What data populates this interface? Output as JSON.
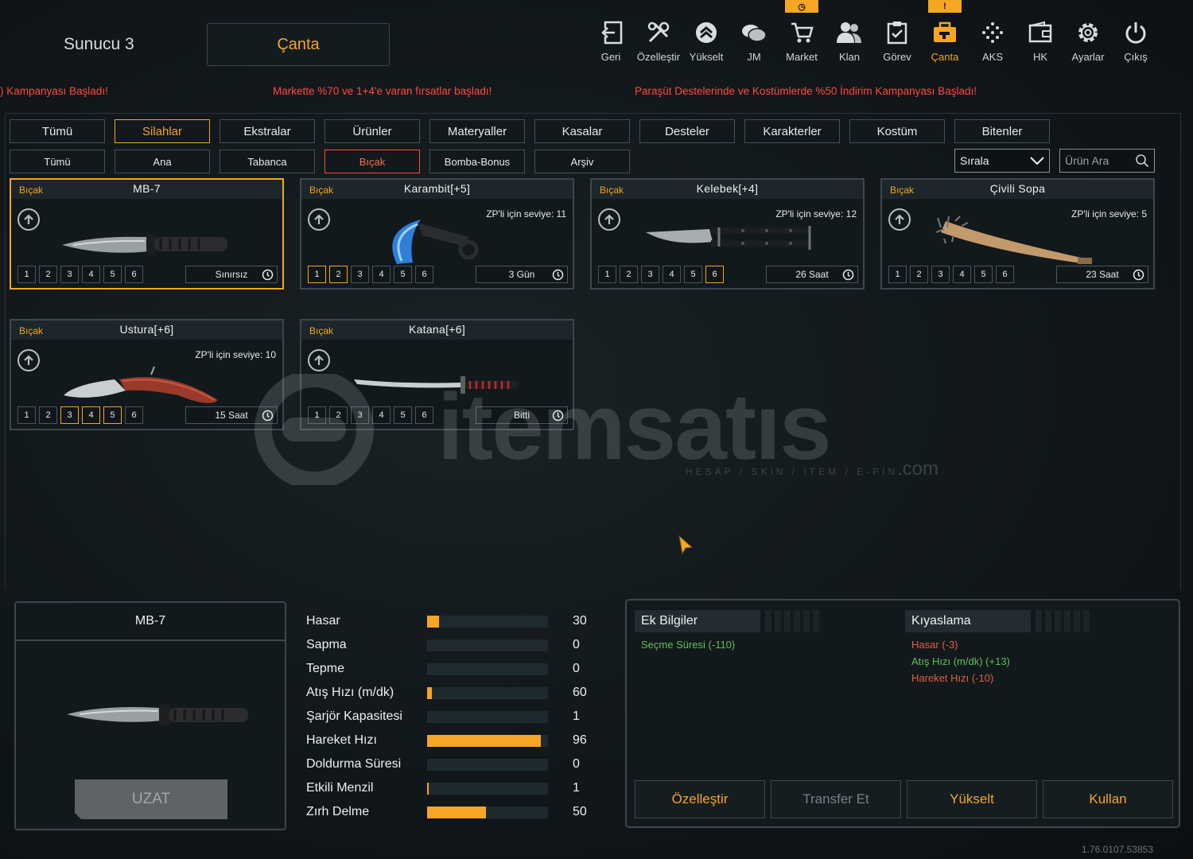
{
  "header": {
    "server": "Sunucu 3",
    "title": "Çanta",
    "nav": [
      {
        "label": "Geri",
        "icon": "back-icon"
      },
      {
        "label": "Özelleştir",
        "icon": "tools-icon"
      },
      {
        "label": "Yükselt",
        "icon": "upgrade-icon"
      },
      {
        "label": "JM",
        "icon": "coins-icon"
      },
      {
        "label": "Market",
        "icon": "cart-icon"
      },
      {
        "label": "Klan",
        "icon": "clan-icon"
      },
      {
        "label": "Görev",
        "icon": "mission-icon"
      },
      {
        "label": "Çanta",
        "icon": "bag-icon"
      },
      {
        "label": "AKS",
        "icon": "aks-icon"
      },
      {
        "label": "HK",
        "icon": "wallet-icon"
      },
      {
        "label": "Ayarlar",
        "icon": "gear-icon"
      },
      {
        "label": "Çıkış",
        "icon": "power-icon"
      }
    ],
    "active_nav": "Çanta"
  },
  "ticker": [
    ") Kampanyası Başladı!",
    "Markette %70 ve 1+4'e varan fırsatlar başladı!",
    "Paraşüt Destelerinde ve Kostümlerde %50 İndirim Kampanyası Başladı!"
  ],
  "tabs": [
    "Tümü",
    "Silahlar",
    "Ekstralar",
    "Ürünler",
    "Materyaller",
    "Kasalar",
    "Desteler",
    "Karakterler",
    "Kostüm",
    "Bitenler"
  ],
  "active_tab": "Silahlar",
  "subtabs": [
    "Tümü",
    "Ana",
    "Tabanca",
    "Bıçak",
    "Bomba-Bonus",
    "Arşiv"
  ],
  "active_subtab": "Bıçak",
  "sort_label": "Sırala",
  "search_placeholder": "Ürün Ara",
  "items": [
    {
      "category": "Bıçak",
      "name": "MB-7",
      "zp": "",
      "duration": "Sınırsız",
      "slots_on": [],
      "selected": true,
      "art": "knife"
    },
    {
      "category": "Bıçak",
      "name": "Karambit[+5]",
      "zp": "ZP'li için seviye: 11",
      "duration": "3 Gün",
      "slots_on": [
        1,
        2
      ],
      "selected": false,
      "art": "karambit"
    },
    {
      "category": "Bıçak",
      "name": "Kelebek[+4]",
      "zp": "ZP'li için seviye: 12",
      "duration": "26 Saat",
      "slots_on": [
        6
      ],
      "selected": false,
      "art": "butterfly"
    },
    {
      "category": "Bıçak",
      "name": "Çivili Sopa",
      "zp": "ZP'li için seviye: 5",
      "duration": "23 Saat",
      "slots_on": [],
      "selected": false,
      "art": "bat"
    },
    {
      "category": "Bıçak",
      "name": "Ustura[+6]",
      "zp": "ZP'li için seviye: 10",
      "duration": "15 Saat",
      "slots_on": [
        3,
        4,
        5
      ],
      "selected": false,
      "art": "razor"
    },
    {
      "category": "Bıçak",
      "name": "Katana[+6]",
      "zp": "",
      "duration": "Bitti",
      "slots_on": [],
      "selected": false,
      "art": "katana"
    }
  ],
  "slot_numbers": [
    "1",
    "2",
    "3",
    "4",
    "5",
    "6"
  ],
  "watermark": {
    "brand": "itemsatıs",
    "tagline": "HESAP / SKIN / ITEM / E-PIN",
    "suffix": ".com"
  },
  "detail": {
    "name": "MB-7",
    "button": "UZAT"
  },
  "stats": [
    {
      "label": "Hasar",
      "value": "30",
      "fill": 0.1
    },
    {
      "label": "Sapma",
      "value": "0",
      "fill": 0
    },
    {
      "label": "Tepme",
      "value": "0",
      "fill": 0
    },
    {
      "label": "Atış Hızı (m/dk)",
      "value": "60",
      "fill": 0.04
    },
    {
      "label": "Şarjör Kapasitesi",
      "value": "1",
      "fill": 0
    },
    {
      "label": "Hareket Hızı",
      "value": "96",
      "fill": 0.94
    },
    {
      "label": "Doldurma Süresi",
      "value": "0",
      "fill": 0
    },
    {
      "label": "Etkili Menzil",
      "value": "1",
      "fill": 0.01
    },
    {
      "label": "Zırh Delme",
      "value": "50",
      "fill": 0.49
    }
  ],
  "info": {
    "extra_title": "Ek Bilgiler",
    "extra_lines": [
      {
        "text": "Seçme Süresi (-110)",
        "tone": "green"
      }
    ],
    "compare_title": "Kıyaslama",
    "compare_lines": [
      {
        "text": "Hasar (-3)",
        "tone": "red"
      },
      {
        "text": "Atış Hızı (m/dk) (+13)",
        "tone": "green"
      },
      {
        "text": "Hareket Hızı (-10)",
        "tone": "red"
      }
    ],
    "buttons": [
      {
        "label": "Özelleştir",
        "enabled": true
      },
      {
        "label": "Transfer Et",
        "enabled": false
      },
      {
        "label": "Yükselt",
        "enabled": true
      },
      {
        "label": "Kullan",
        "enabled": true
      }
    ]
  },
  "version": "1.76.0107.53853",
  "colors": {
    "accent": "#f5a623",
    "alert": "#ff4a3d",
    "positive": "#5fc05a",
    "negative": "#e0603e"
  }
}
